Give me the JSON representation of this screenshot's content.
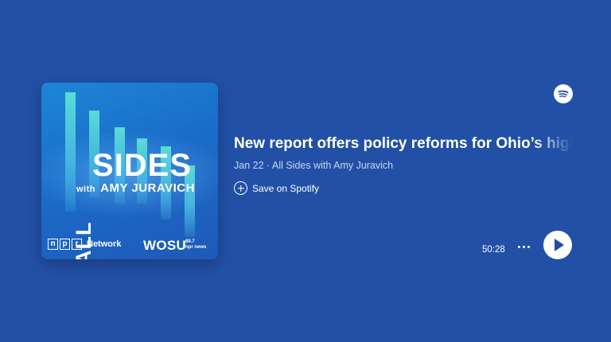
{
  "episode": {
    "title": "New report offers policy reforms for Ohio’s high",
    "date": "Jan 22",
    "separator": "·",
    "show": "All Sides with Amy Juravich",
    "save_label": "Save on Spotify",
    "duration": "50:28"
  },
  "artwork": {
    "all": "ALL",
    "sides": "SIDES",
    "with": "with",
    "host": "AMY JURAVICH",
    "npr_letters": [
      "n",
      "p",
      "r"
    ],
    "network": "Network",
    "station": "WOSU",
    "station_freq": "89.7",
    "station_sub": "npr news"
  },
  "icons": {
    "brand": "spotify-logo-icon",
    "save": "plus-circle-icon",
    "more": "more-horizontal-icon",
    "play": "play-icon"
  },
  "colors": {
    "background": "#214ea3",
    "text_secondary": "#c9d6f0",
    "accent_bars": "#5fe7d6"
  }
}
